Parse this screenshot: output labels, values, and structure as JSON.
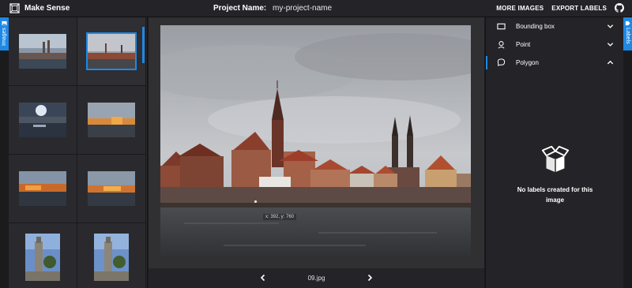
{
  "app": {
    "title": "Make Sense",
    "project_label": "Project Name:",
    "project_name": "my-project-name"
  },
  "toolbar": {
    "more_images": "MORE IMAGES",
    "export_labels": "EXPORT LABELS"
  },
  "side_tabs": {
    "left": "Images",
    "right": "Labels"
  },
  "images": [
    {
      "theme": "cathedral-cloudy",
      "selected": false
    },
    {
      "theme": "cathedral-cloudy-wide",
      "selected": true
    },
    {
      "theme": "riverside-sunburst",
      "selected": false
    },
    {
      "theme": "riverside-golden",
      "selected": false
    },
    {
      "theme": "riverside-sunset",
      "selected": false
    },
    {
      "theme": "riverside-sunset-2",
      "selected": false
    },
    {
      "theme": "tower-square",
      "selected": false
    },
    {
      "theme": "tower-square-2",
      "selected": false
    }
  ],
  "editor": {
    "cursor_readout": "x: 392, y: 760",
    "file_name": "09.jpg"
  },
  "label_tools": [
    {
      "label": "Bounding box",
      "icon": "rectangle-icon",
      "expanded": false,
      "active": false
    },
    {
      "label": "Point",
      "icon": "point-icon",
      "expanded": false,
      "active": false
    },
    {
      "label": "Polygon",
      "icon": "polygon-icon",
      "expanded": true,
      "active": true
    }
  ],
  "empty_state": {
    "text": "No labels created for this image"
  },
  "colors": {
    "accent": "#1e88e5",
    "topbar": "#242428",
    "editor": "#303033"
  }
}
